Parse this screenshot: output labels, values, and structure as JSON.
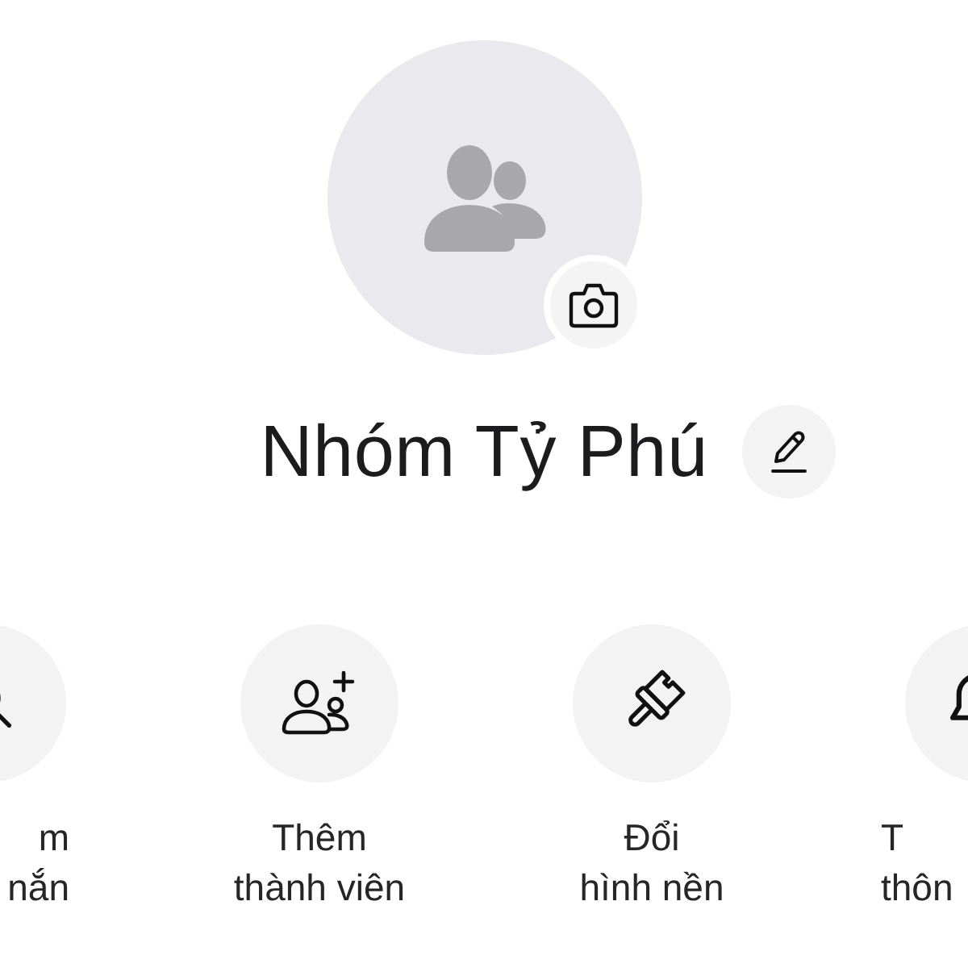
{
  "group": {
    "name": "Nhóm Tỷ Phú"
  },
  "actions": [
    {
      "label": "m\nnắn"
    },
    {
      "label": "Thêm\nthành viên"
    },
    {
      "label": "Đổi\nhình nền"
    },
    {
      "label": "T\nthôn"
    }
  ]
}
